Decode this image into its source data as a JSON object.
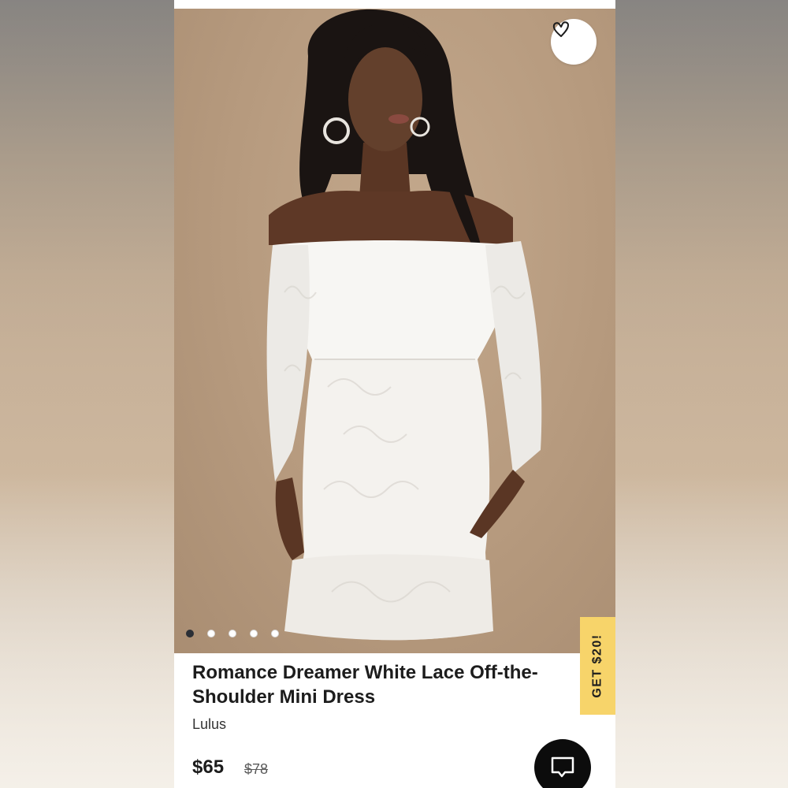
{
  "product": {
    "title": "Romance Dreamer White Lace Off-the-Shoulder Mini Dress",
    "brand": "Lulus",
    "price": "$65",
    "original_price": "$78"
  },
  "gallery": {
    "image_count": 5,
    "active_index": 0,
    "image_subject": "model in white lace off-the-shoulder mini dress"
  },
  "actions": {
    "favorite_icon": "heart-icon",
    "chat_icon": "chat-bubble-icon"
  },
  "promo": {
    "label": "GET $20!"
  },
  "colors": {
    "promo_bg": "#f7d46a",
    "active_dot": "#2b2f36",
    "photo_bg": "#b69a7e",
    "text": "#1c1c1c"
  }
}
